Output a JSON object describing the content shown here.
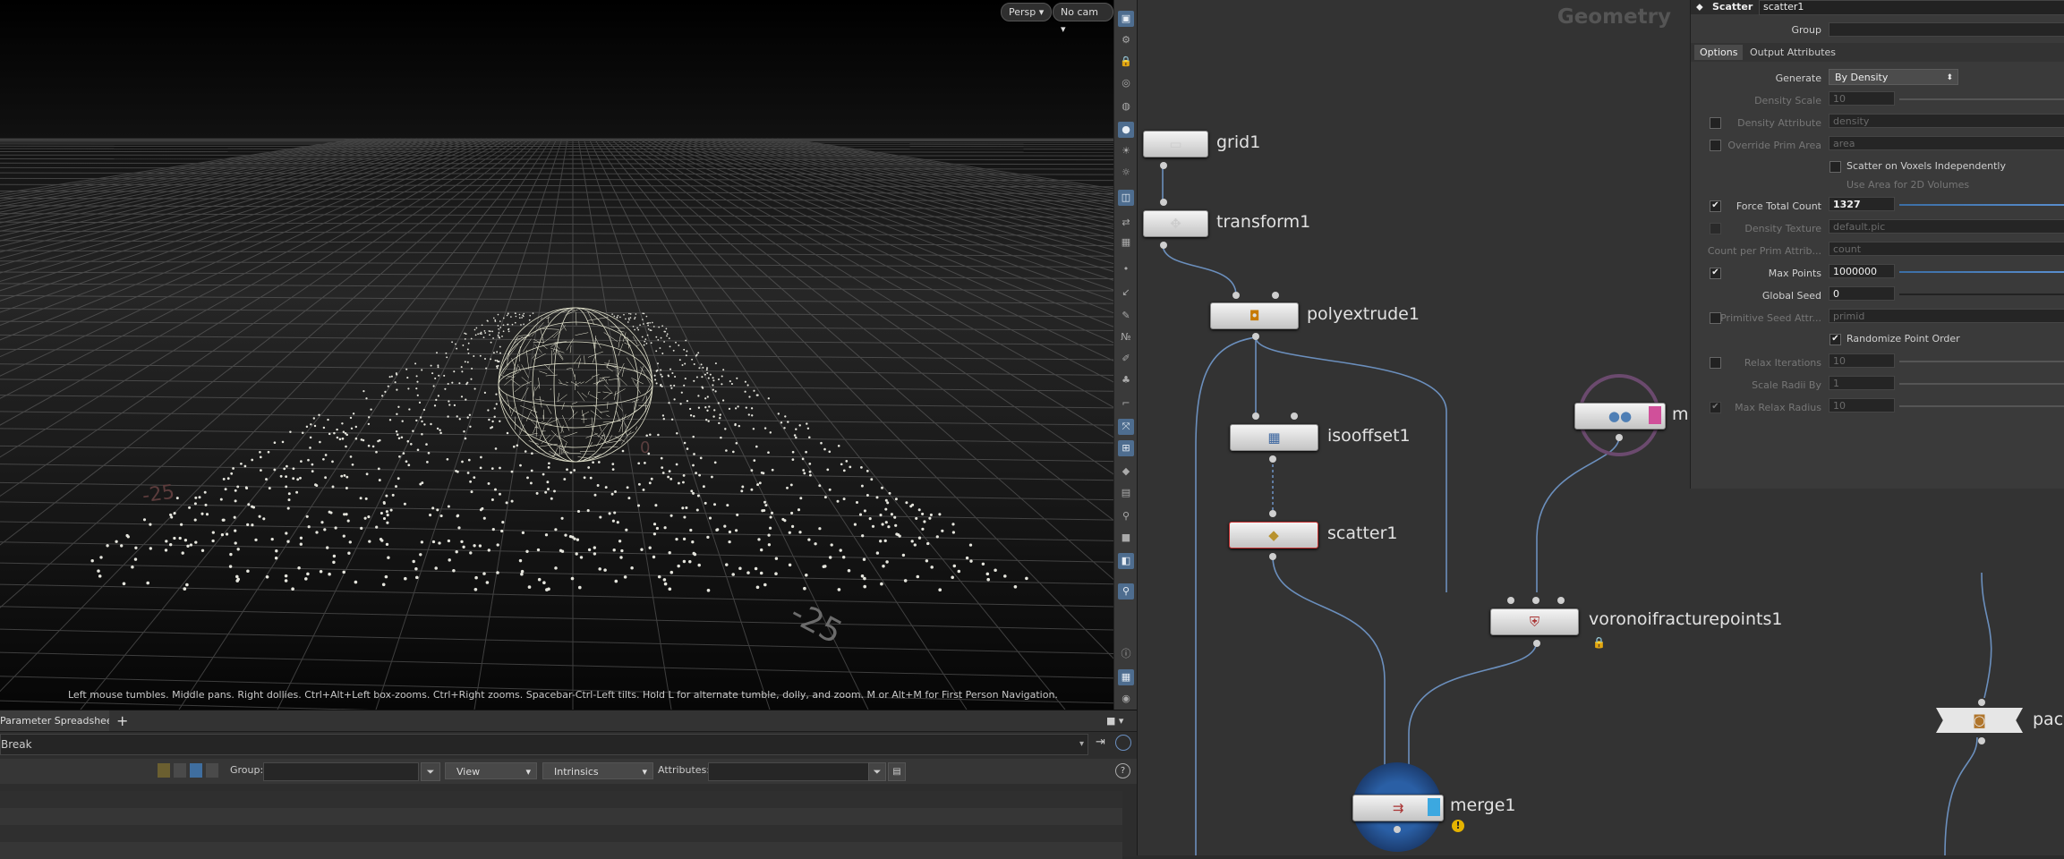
{
  "viewport": {
    "persp_label": "Persp",
    "cam_label": "No cam",
    "hint": "Left mouse tumbles. Middle pans. Right dollies. Ctrl+Alt+Left box-zooms. Ctrl+Right zooms. Spacebar-Ctrl-Left tilts. Hold L for alternate tumble, dolly, and zoom.      M or Alt+M for First Person Navigation.",
    "grid_labels": [
      "0",
      "-25"
    ]
  },
  "spreadsheet": {
    "tab_label": "Parameter Spreadsheet",
    "tab_close": "×",
    "add_tab": "+",
    "path": "Break",
    "group_label": "Group:",
    "view_label": "View",
    "intrinsics_label": "Intrinsics",
    "attributes_label": "Attributes:"
  },
  "network": {
    "context_title": "Geometry",
    "nodes": {
      "grid": "grid1",
      "transform": "transform1",
      "polyextrude": "polyextrude1",
      "isooffset": "isooffset1",
      "scatter": "scatter1",
      "voronoi": "voronoifracturepoints1",
      "merge": "merge1",
      "partial_m": "m",
      "partial_pac": "pac"
    }
  },
  "params": {
    "node_type": "Scatter",
    "node_name": "scatter1",
    "group_label": "Group",
    "tabs": [
      "Options",
      "Output Attributes"
    ],
    "generate_label": "Generate",
    "generate_value": "By Density",
    "density_scale_label": "Density Scale",
    "density_scale_value": "10",
    "density_attr_label": "Density Attribute",
    "density_attr_value": "density",
    "override_prim_label": "Override Prim Area",
    "override_prim_value": "area",
    "scatter_voxels_label": "Scatter on Voxels Independently",
    "use_area_label": "Use Area for 2D Volumes",
    "force_total_label": "Force Total Count",
    "force_total_value": "1327",
    "density_texture_label": "Density Texture",
    "density_texture_value": "default.pic",
    "count_per_prim_label": "Count per Prim Attrib...",
    "count_per_prim_value": "count",
    "max_points_label": "Max Points",
    "max_points_value": "1000000",
    "global_seed_label": "Global Seed",
    "global_seed_value": "0",
    "prim_seed_label": "Primitive Seed Attr...",
    "prim_seed_value": "primid",
    "randomize_label": "Randomize Point Order",
    "relax_iter_label": "Relax Iterations",
    "relax_iter_value": "10",
    "scale_radii_label": "Scale Radii By",
    "scale_radii_value": "1",
    "max_relax_label": "Max Relax Radius",
    "max_relax_value": "10"
  }
}
